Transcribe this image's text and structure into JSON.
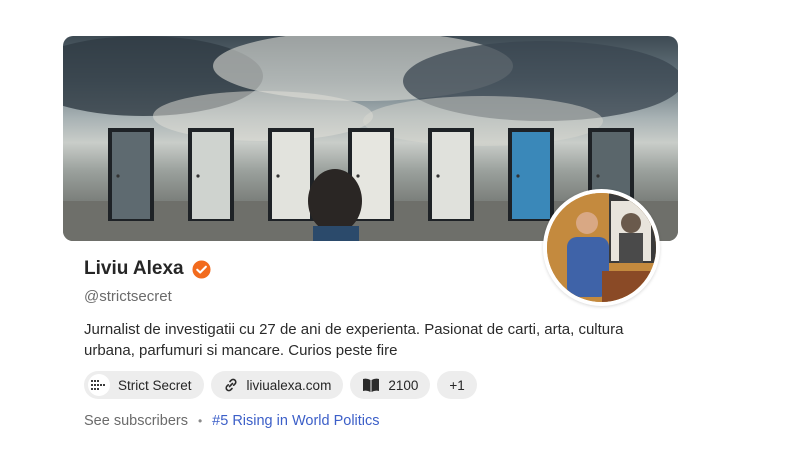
{
  "profile": {
    "name": "Liviu Alexa",
    "handle": "@strictsecret",
    "bio": "Jurnalist de investigatii cu 27 de ani de experienta. Pasionat de carti, arta, cultura urbana, parfumuri si mancare. Curios peste fire",
    "verified_color": "#f26b1d"
  },
  "chips": {
    "publication": {
      "label": "Strict Secret",
      "icon": "publication-logo-icon"
    },
    "website": {
      "label": "liviualexa.com",
      "icon": "link-icon"
    },
    "books": {
      "label": "2100",
      "icon": "open-book-icon"
    },
    "more": {
      "label": "+1"
    }
  },
  "footer": {
    "subscribers_label": "See subscribers",
    "separator": "•",
    "rank_label": "#5 Rising in World Politics",
    "rank_color": "#3c5fc8"
  },
  "banner": {
    "description_icon": "doors-banner-image",
    "door_colors": [
      "#5e6a70",
      "#cfd3cf",
      "#e2e3dd",
      "#e6e6e0",
      "#e0e1dc",
      "#3a88b9",
      "#5a666b"
    ]
  }
}
